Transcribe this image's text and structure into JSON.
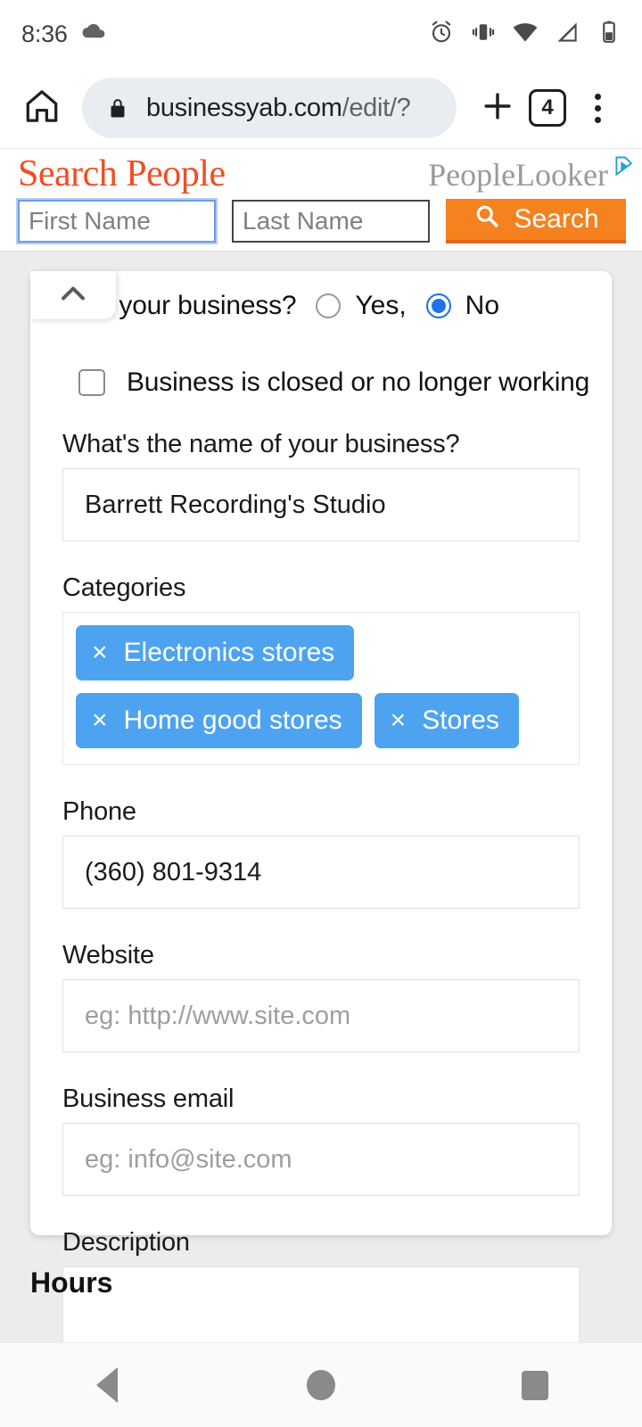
{
  "status_bar": {
    "time": "8:36",
    "icons": [
      "cloud-icon",
      "alarm-icon",
      "vibrate-icon",
      "wifi-icon",
      "signal-icon",
      "battery-icon"
    ]
  },
  "browser": {
    "home_icon": "home-icon",
    "lock_icon": "lock-icon",
    "url_domain": "businessyab.com",
    "url_path": "/edit/?",
    "new_tab_icon": "plus-icon",
    "tab_count": "4",
    "menu_icon": "overflow-menu-icon"
  },
  "ad": {
    "headline": "Search People",
    "brand": "PeopleLooker",
    "adchoices_icon": "adchoices-icon",
    "first_name_placeholder": "First Name",
    "last_name_placeholder": "Last Name",
    "search_button": "Search",
    "search_icon": "magnifier-icon",
    "accent_color": "#f5821f",
    "headline_color": "#f04e23"
  },
  "form": {
    "collapse_icon": "chevron-up-icon",
    "ownership_question": "is your business?",
    "radio_yes": "Yes,",
    "radio_no": "No",
    "selected_radio": "No",
    "closed_checkbox_label": "Business is closed or no longer working",
    "closed_checkbox_checked": false,
    "name_label": "What's the name of your business?",
    "name_value": "Barrett Recording's Studio",
    "categories_label": "Categories",
    "categories": [
      {
        "label": "Electronics stores",
        "remove_icon": "close-icon"
      },
      {
        "label": "Home good stores",
        "remove_icon": "close-icon"
      },
      {
        "label": "Stores",
        "remove_icon": "close-icon"
      }
    ],
    "chip_color": "#4ea3f0",
    "phone_label": "Phone",
    "phone_value": "(360) 801-9314",
    "website_label": "Website",
    "website_placeholder": "eg: http://www.site.com",
    "email_label": "Business email",
    "email_placeholder": "eg: info@site.com",
    "description_label": "Description",
    "description_value": "",
    "hours_heading": "Hours"
  },
  "nav_bar": {
    "back_icon": "back-triangle-icon",
    "home_icon": "home-circle-icon",
    "recents_icon": "recents-square-icon"
  }
}
